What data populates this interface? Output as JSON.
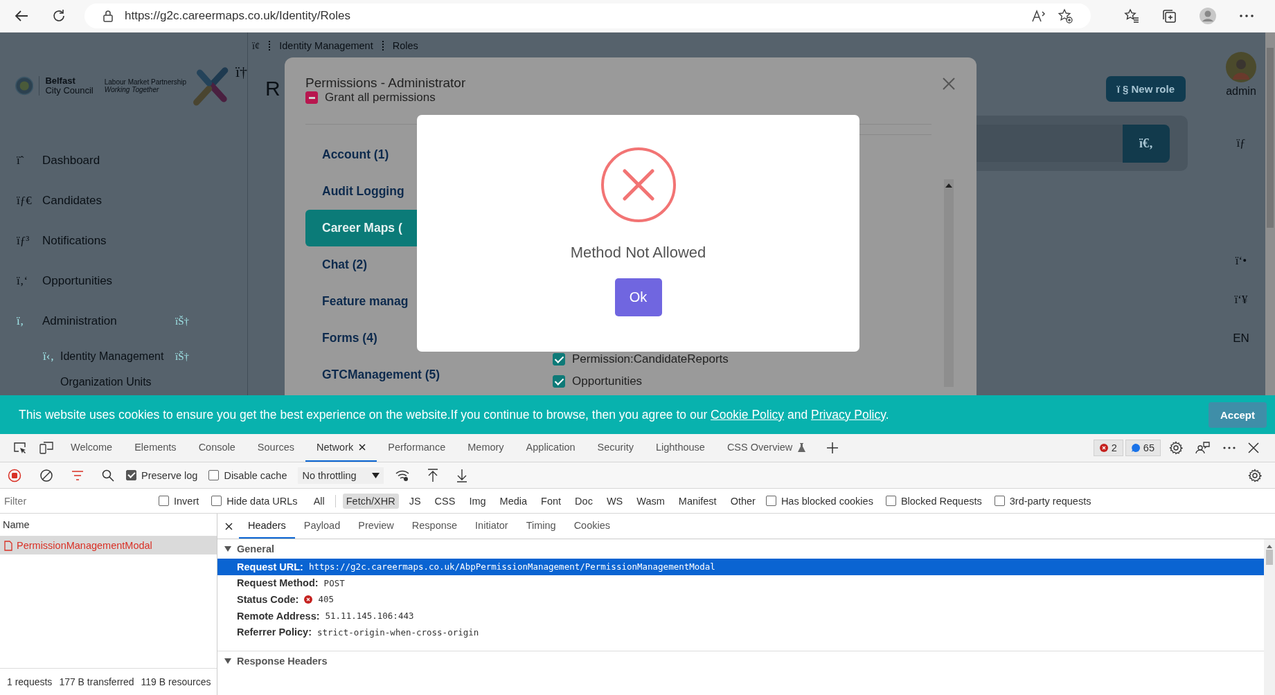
{
  "browser": {
    "url": "https://g2c.careermaps.co.uk/Identity/Roles"
  },
  "app": {
    "logo": {
      "council": [
        "Belfast",
        "City Council"
      ],
      "partnership": "Labour Market Partnership",
      "tagline": "Working Together",
      "glyph": "ï†"
    },
    "breadcrumb": [
      "ï¢",
      "Identity Management",
      "Roles"
    ],
    "sidebar": [
      {
        "icon": "ïˆ",
        "label": "Dashboard",
        "active": false
      },
      {
        "icon": "ïƒ€",
        "label": "Candidates",
        "active": false
      },
      {
        "icon": "ïƒ³",
        "label": "Notifications",
        "active": false
      },
      {
        "icon": "ï‚‘",
        "label": "Opportunities",
        "active": false
      },
      {
        "icon": "ï‚",
        "label": "Administration",
        "active": true,
        "toggle": "ïŠ†",
        "children": [
          {
            "icon": "ï‹‚",
            "label": "Identity Management",
            "active": true,
            "toggle": "ïŠ†",
            "children": [
              {
                "label": "Organization Units",
                "active": false
              }
            ]
          }
        ]
      }
    ],
    "page_title": "R",
    "new_role_button": "ï § New role",
    "search_button": "ï€‚",
    "user": {
      "name": "admin"
    },
    "right_rail": [
      "ïƒ",
      "ï‘•",
      "ï‘¥",
      "EN"
    ]
  },
  "permissions_modal": {
    "title": "Permissions - Administrator",
    "grant_all": {
      "label": "Grant all permissions",
      "indeterminate": true
    },
    "groups": [
      {
        "label": "Account (1)",
        "selected": false
      },
      {
        "label": "Audit Logging",
        "selected": false
      },
      {
        "label": "Career Maps (",
        "selected": true
      },
      {
        "label": "Chat (2)",
        "selected": false
      },
      {
        "label": "Feature manag",
        "selected": false
      },
      {
        "label": "Forms (4)",
        "selected": false
      },
      {
        "label": "GTCManagement (5)",
        "selected": false
      }
    ],
    "permissions": [
      {
        "label": "Permission:CandidateReports",
        "checked": true
      },
      {
        "label": "Opportunities",
        "checked": true
      }
    ]
  },
  "alert": {
    "kind": "error",
    "message": "Method Not Allowed",
    "button": "Ok"
  },
  "cookie_banner": {
    "parts": [
      {
        "text": "This website uses cookies to ensure you get the best experience on the website.If you continue to browse, then you agree to our ",
        "link": false
      },
      {
        "text": "Cookie Policy",
        "link": true
      },
      {
        "text": " and ",
        "link": false
      },
      {
        "text": "Privacy Policy",
        "link": true
      },
      {
        "text": ".",
        "link": false
      }
    ],
    "button": "Accept"
  },
  "devtools": {
    "tabs": [
      {
        "label": "Welcome",
        "selected": false,
        "closable": false,
        "experimental": false
      },
      {
        "label": "Elements",
        "selected": false,
        "closable": false,
        "experimental": false
      },
      {
        "label": "Console",
        "selected": false,
        "closable": false,
        "experimental": false
      },
      {
        "label": "Sources",
        "selected": false,
        "closable": false,
        "experimental": false
      },
      {
        "label": "Network",
        "selected": true,
        "closable": true,
        "experimental": false
      },
      {
        "label": "Performance",
        "selected": false,
        "closable": false,
        "experimental": false
      },
      {
        "label": "Memory",
        "selected": false,
        "closable": false,
        "experimental": false
      },
      {
        "label": "Application",
        "selected": false,
        "closable": false,
        "experimental": false
      },
      {
        "label": "Security",
        "selected": false,
        "closable": false,
        "experimental": false
      },
      {
        "label": "Lighthouse",
        "selected": false,
        "closable": false,
        "experimental": false
      },
      {
        "label": "CSS Overview",
        "selected": false,
        "closable": false,
        "experimental": true
      }
    ],
    "issues": {
      "errors": "2",
      "messages": "65"
    },
    "toolbar": {
      "preserve_log": {
        "label": "Preserve log",
        "checked": true
      },
      "disable_cache": {
        "label": "Disable cache",
        "checked": false
      },
      "throttling": "No throttling"
    },
    "filter": {
      "placeholder": "Filter",
      "invert": {
        "label": "Invert",
        "checked": false
      },
      "hide_data_urls": {
        "label": "Hide data URLs",
        "checked": false
      },
      "types": [
        {
          "label": "All",
          "selected": false
        },
        {
          "label": "Fetch/XHR",
          "selected": true
        },
        {
          "label": "JS",
          "selected": false
        },
        {
          "label": "CSS",
          "selected": false
        },
        {
          "label": "Img",
          "selected": false
        },
        {
          "label": "Media",
          "selected": false
        },
        {
          "label": "Font",
          "selected": false
        },
        {
          "label": "Doc",
          "selected": false
        },
        {
          "label": "WS",
          "selected": false
        },
        {
          "label": "Wasm",
          "selected": false
        },
        {
          "label": "Manifest",
          "selected": false
        },
        {
          "label": "Other",
          "selected": false
        }
      ],
      "options": [
        {
          "label": "Has blocked cookies",
          "checked": false
        },
        {
          "label": "Blocked Requests",
          "checked": false
        },
        {
          "label": "3rd-party requests",
          "checked": false
        }
      ]
    },
    "requests": {
      "column": "Name",
      "rows": [
        {
          "name": "PermissionManagementModal",
          "selected": true,
          "failed": true
        }
      ],
      "summary": [
        "1 requests",
        "177 B transferred",
        "119 B resources"
      ]
    },
    "details": {
      "tabs": [
        {
          "label": "Headers",
          "selected": true
        },
        {
          "label": "Payload",
          "selected": false
        },
        {
          "label": "Preview",
          "selected": false
        },
        {
          "label": "Response",
          "selected": false
        },
        {
          "label": "Initiator",
          "selected": false
        },
        {
          "label": "Timing",
          "selected": false
        },
        {
          "label": "Cookies",
          "selected": false
        }
      ],
      "general": {
        "title": "General",
        "expanded": true,
        "rows": [
          {
            "label": "Request URL:",
            "value": "https://g2c.careermaps.co.uk/AbpPermissionManagement/PermissionManagementModal",
            "selected": true,
            "error": false
          },
          {
            "label": "Request Method:",
            "value": "POST",
            "selected": false,
            "error": false
          },
          {
            "label": "Status Code:",
            "value": "405",
            "selected": false,
            "error": true
          },
          {
            "label": "Remote Address:",
            "value": "51.11.145.106:443",
            "selected": false,
            "error": false
          },
          {
            "label": "Referrer Policy:",
            "value": "strict-origin-when-cross-origin",
            "selected": false,
            "error": false
          }
        ]
      },
      "response_headers": {
        "title": "Response Headers",
        "expanded": true
      }
    }
  }
}
